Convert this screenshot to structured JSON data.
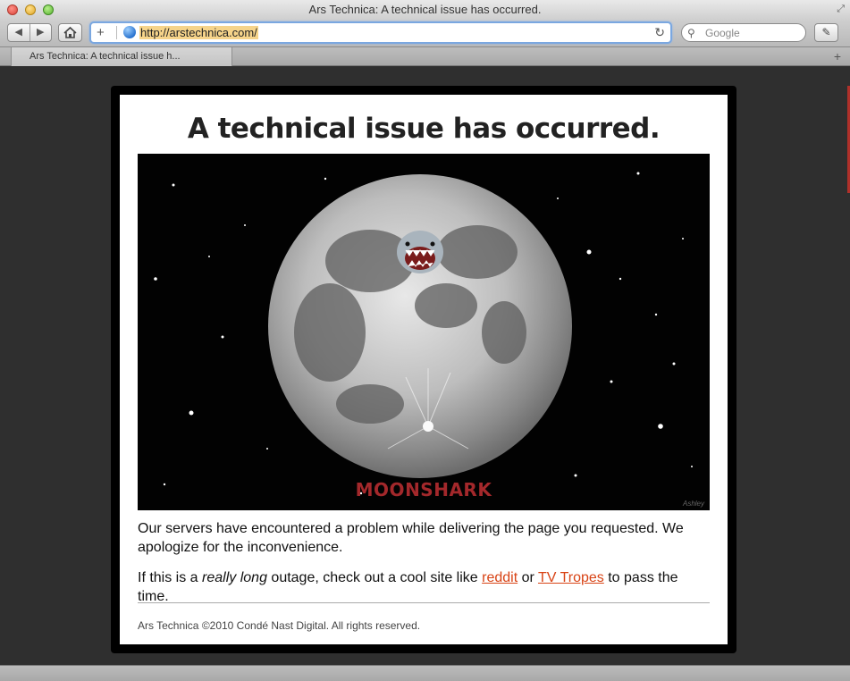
{
  "window": {
    "title": "Ars Technica: A technical issue has occurred."
  },
  "toolbar": {
    "url": "http://arstechnica.com/",
    "search_placeholder": "Google",
    "back_glyph": "◀",
    "forward_glyph": "▶",
    "reload_glyph": "↻",
    "add_glyph": "+"
  },
  "tabs": [
    {
      "label": "Ars Technica: A technical issue h..."
    }
  ],
  "page": {
    "heading": "A technical issue has occurred.",
    "image_caption": "MOONSHARK",
    "image_signature": "Ashley",
    "paragraph1": "Our servers have encountered a problem while delivering the page you requested. We apologize for the inconvenience.",
    "p2_before": "If this is a ",
    "p2_emphasis": "really long",
    "p2_middle": " outage, check out a cool site like ",
    "link_reddit": "reddit",
    "p2_or": " or ",
    "link_tvtropes": "TV Tropes",
    "p2_after": " to pass the time.",
    "footer": "Ars Technica ©2010 Condé Nast Digital. All rights reserved."
  },
  "colors": {
    "link": "#d84315",
    "caption": "#a3282b",
    "page_background": "#2f2f2f"
  }
}
